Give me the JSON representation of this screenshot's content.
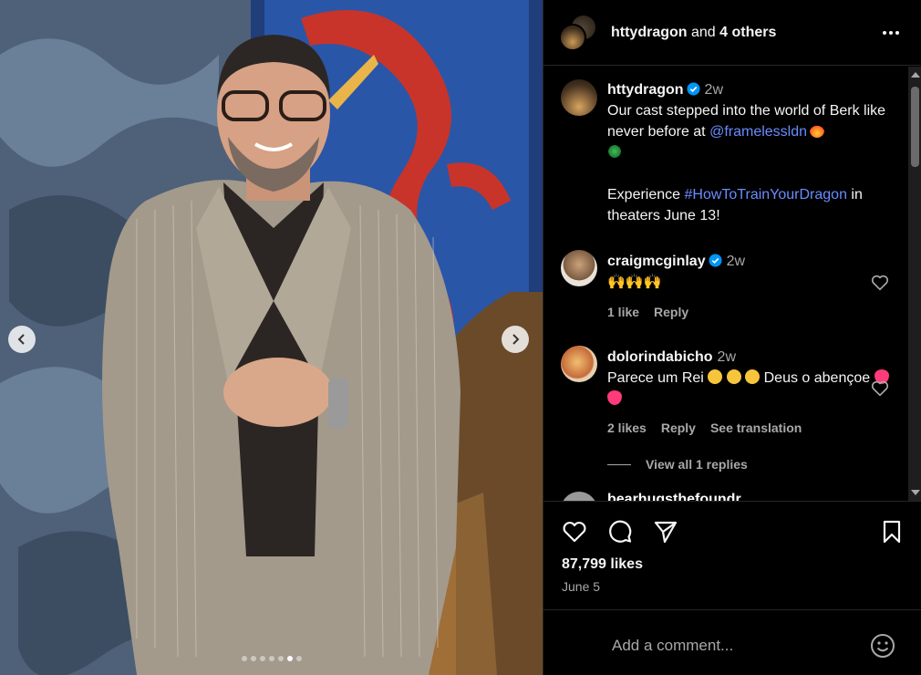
{
  "header": {
    "username": "httydragon",
    "and_text": "and",
    "others": "4 others"
  },
  "caption": {
    "username": "httydragon",
    "time": "2w",
    "line1": "Our cast stepped into the world of Berk like never before at ",
    "mention": "@framelessldn",
    "line2": "Experience ",
    "hashtag": "#HowToTrainYourDragon",
    "line3": " in theaters June 13!"
  },
  "comments": [
    {
      "username": "craigmcginlay",
      "time": "2w",
      "text": "🙌🙌🙌",
      "likes": "1 like",
      "reply": "Reply"
    },
    {
      "username": "dolorindabicho",
      "time": "2w",
      "text_a": "Parece um Rei ",
      "text_b": " Deus o abençoe ",
      "likes": "2 likes",
      "reply": "Reply",
      "translate": "See translation",
      "view_replies": "View all 1 replies"
    },
    {
      "username_partial": "bearhugsthefoundr..."
    }
  ],
  "post": {
    "likes": "87,799 likes",
    "date": "June 5"
  },
  "comment_input": {
    "placeholder": "Add a comment..."
  },
  "carousel": {
    "total": 7,
    "active_index": 5
  },
  "colors": {
    "link": "#6a8cff",
    "verified": "#0095f6",
    "muted": "#a8a8a8"
  }
}
